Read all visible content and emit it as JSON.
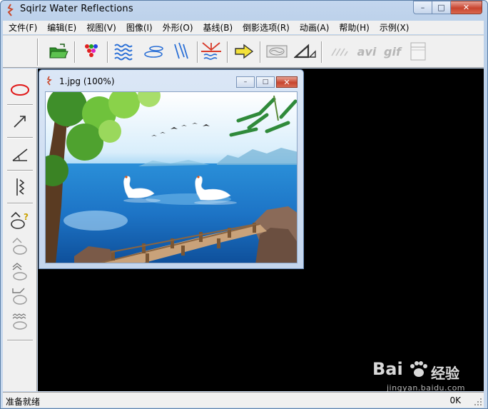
{
  "window": {
    "title": "Sqirlz Water Reflections",
    "controls": {
      "minimize": "–",
      "maximize": "□",
      "close": "✕"
    }
  },
  "menu": [
    "文件(F)",
    "编辑(E)",
    "视图(V)",
    "图像(I)",
    "外形(O)",
    "基线(B)",
    "倒影选项(R)",
    "动画(A)",
    "帮助(H)",
    "示例(X)"
  ],
  "toolbar": {
    "buttons": [
      {
        "icon": "open-folder-icon"
      },
      {
        "icon": "color-dots-icon"
      },
      {
        "icon": "water-waves-icon"
      },
      {
        "icon": "ripple-ellipses-icon"
      },
      {
        "icon": "rain-lines-icon"
      },
      {
        "icon": "reflection-baseline-icon"
      },
      {
        "icon": "play-arrow-icon"
      },
      {
        "icon": "image-frame-icon"
      },
      {
        "icon": "triangle-icon"
      },
      {
        "icon": "light-rays-icon"
      },
      {
        "icon": "avi-text-icon",
        "label": "avi"
      },
      {
        "icon": "gif-text-icon",
        "label": "gif"
      },
      {
        "icon": "document-page-icon"
      }
    ]
  },
  "tools": [
    {
      "icon": "ellipse-tool-icon"
    },
    {
      "icon": "arrow-tool-icon"
    },
    {
      "icon": "angle-tool-icon"
    },
    {
      "icon": "zigzag-tool-icon"
    },
    {
      "icon": "question-wave-tool-icon"
    },
    {
      "icon": "wave-circle-tool-icon"
    },
    {
      "icon": "double-wave-tool-icon"
    },
    {
      "icon": "step-wave-tool-icon"
    },
    {
      "icon": "wavy-lines-tool-icon"
    }
  ],
  "child_window": {
    "title": "1.jpg  (100%)",
    "controls": {
      "minimize": "–",
      "maximize": "□",
      "close": "✕"
    }
  },
  "status": {
    "left": "准备就绪",
    "right": "0K"
  },
  "watermark": {
    "logo": "Bai",
    "cn": "经验",
    "sub": "jingyan.baidu.com"
  },
  "colors": {
    "accent": "#1e6fc0",
    "close_red": "#c8442f",
    "work_bg": "#000000",
    "chrome": "#f0f0f0"
  }
}
